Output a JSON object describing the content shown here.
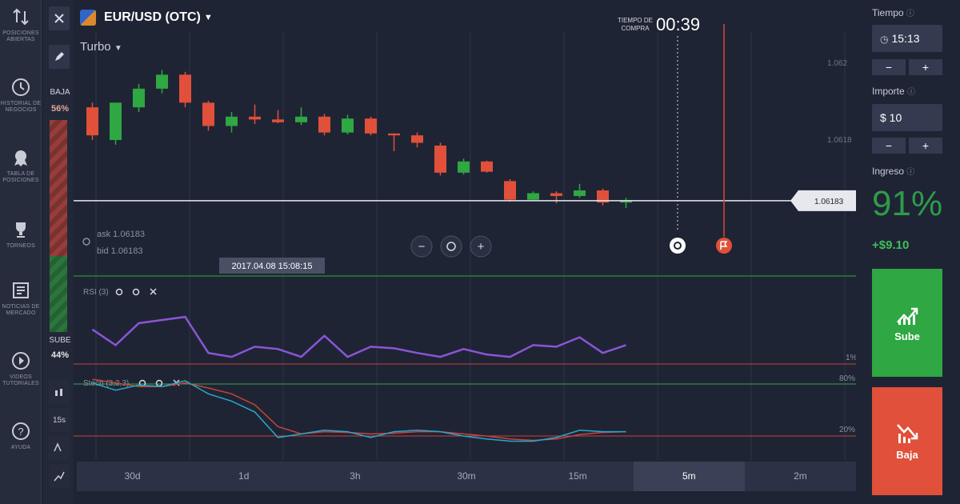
{
  "nav": {
    "items": [
      {
        "label": "POSICIONES ABIERTAS",
        "icon": "swap-arrows-icon"
      },
      {
        "label": "HISTORIAL DE NEGOCIOS",
        "icon": "clock-icon"
      },
      {
        "label": "TABLA DE POSICIONES",
        "icon": "medal-icon"
      },
      {
        "label": "TORNEOS",
        "icon": "trophy-icon"
      },
      {
        "label": "NOTICIAS DE MERCADO",
        "icon": "news-icon"
      },
      {
        "label": "VIDEOS TUTORIALES",
        "icon": "play-icon"
      },
      {
        "label": "AYUDA",
        "icon": "help-icon"
      }
    ]
  },
  "tools": {
    "close_icon": "close-icon",
    "draw_icon": "pencil-icon"
  },
  "sentiment": {
    "sell_label": "BAJA",
    "sell_pct": "56%",
    "buy_label": "SUBE",
    "buy_pct": "44%"
  },
  "header": {
    "asset": "EUR/USD (OTC)",
    "mode": "Turbo"
  },
  "timer": {
    "label": "TIEMPO DE COMPRA",
    "value": "00:39"
  },
  "price_panel": {
    "ask": "ask 1.06183",
    "bid": "bid 1.06183",
    "current_price": "1.06183",
    "date_tooltip": "2017.04.08 15:08:15",
    "levels": [
      "1.062",
      "1.0618",
      "1.06183"
    ]
  },
  "indicators": {
    "rsi": {
      "label": "RSI (3)",
      "level": "1%"
    },
    "stoch": {
      "label": "Stoch (3,3,3)",
      "upper": "80%",
      "lower": "20%"
    }
  },
  "timeframes": [
    "30d",
    "1d",
    "3h",
    "30m",
    "15m",
    "5m",
    "2m"
  ],
  "active_timeframe": "5m",
  "right": {
    "time_label": "Tiempo",
    "time_value": "15:13",
    "amount_label": "Importe",
    "amount_value": "$ 10",
    "income_label": "Ingreso",
    "payout_pct": "91%",
    "payout_amt": "+$9.10",
    "up_label": "Sube",
    "down_label": "Baja"
  },
  "colors": {
    "up": "#2fa742",
    "down": "#e0503a",
    "rsi": "#8a55d6",
    "stoch_k": "#2aa6c9",
    "stoch_d": "#c4453d",
    "background": "#1f2434"
  },
  "chart_data": {
    "type": "candlestick",
    "candles": [
      {
        "o": 1.06295,
        "h": 1.063,
        "l": 1.0626,
        "c": 1.06265
      },
      {
        "o": 1.0626,
        "h": 1.063,
        "l": 1.06255,
        "c": 1.063
      },
      {
        "o": 1.06295,
        "h": 1.0632,
        "l": 1.0629,
        "c": 1.06315
      },
      {
        "o": 1.06315,
        "h": 1.06335,
        "l": 1.0631,
        "c": 1.0633
      },
      {
        "o": 1.0633,
        "h": 1.06333,
        "l": 1.06295,
        "c": 1.063
      },
      {
        "o": 1.063,
        "h": 1.06302,
        "l": 1.0627,
        "c": 1.06275
      },
      {
        "o": 1.06275,
        "h": 1.0629,
        "l": 1.06268,
        "c": 1.06285
      },
      {
        "o": 1.06285,
        "h": 1.06298,
        "l": 1.06277,
        "c": 1.06282
      },
      {
        "o": 1.06282,
        "h": 1.06292,
        "l": 1.06278,
        "c": 1.06279
      },
      {
        "o": 1.06279,
        "h": 1.06295,
        "l": 1.06276,
        "c": 1.06285
      },
      {
        "o": 1.06285,
        "h": 1.06288,
        "l": 1.06265,
        "c": 1.06268
      },
      {
        "o": 1.06268,
        "h": 1.06287,
        "l": 1.06266,
        "c": 1.06283
      },
      {
        "o": 1.06283,
        "h": 1.06285,
        "l": 1.06265,
        "c": 1.06267
      },
      {
        "o": 1.06267,
        "h": 1.06267,
        "l": 1.06248,
        "c": 1.06265
      },
      {
        "o": 1.06265,
        "h": 1.06268,
        "l": 1.06252,
        "c": 1.06257
      },
      {
        "o": 1.06254,
        "h": 1.06257,
        "l": 1.06222,
        "c": 1.06225
      },
      {
        "o": 1.06225,
        "h": 1.0624,
        "l": 1.06223,
        "c": 1.06237
      },
      {
        "o": 1.06237,
        "h": 1.06238,
        "l": 1.06225,
        "c": 1.06226
      },
      {
        "o": 1.06216,
        "h": 1.06218,
        "l": 1.06194,
        "c": 1.06196
      },
      {
        "o": 1.06196,
        "h": 1.06205,
        "l": 1.06195,
        "c": 1.06203
      },
      {
        "o": 1.06203,
        "h": 1.06205,
        "l": 1.06192,
        "c": 1.062
      },
      {
        "o": 1.062,
        "h": 1.06213,
        "l": 1.06198,
        "c": 1.06206
      },
      {
        "o": 1.06206,
        "h": 1.06208,
        "l": 1.0619,
        "c": 1.06193
      },
      {
        "o": 1.06193,
        "h": 1.06198,
        "l": 1.06187,
        "c": 1.06195
      }
    ],
    "rsi": [
      40,
      20,
      48,
      52,
      56,
      10,
      5,
      18,
      15,
      5,
      32,
      5,
      18,
      16,
      10,
      5,
      15,
      8,
      5,
      20,
      18,
      30,
      10,
      20
    ],
    "stoch_k": [
      85,
      75,
      82,
      80,
      88,
      70,
      60,
      45,
      10,
      15,
      20,
      18,
      10,
      18,
      20,
      18,
      12,
      8,
      5,
      5,
      10,
      20,
      18,
      18
    ],
    "stoch_d": [
      90,
      85,
      80,
      80,
      85,
      78,
      70,
      55,
      25,
      15,
      18,
      17,
      15,
      16,
      18,
      18,
      15,
      12,
      8,
      6,
      8,
      14,
      17,
      18
    ],
    "ylim": [
      1.0617,
      1.0635
    ]
  }
}
